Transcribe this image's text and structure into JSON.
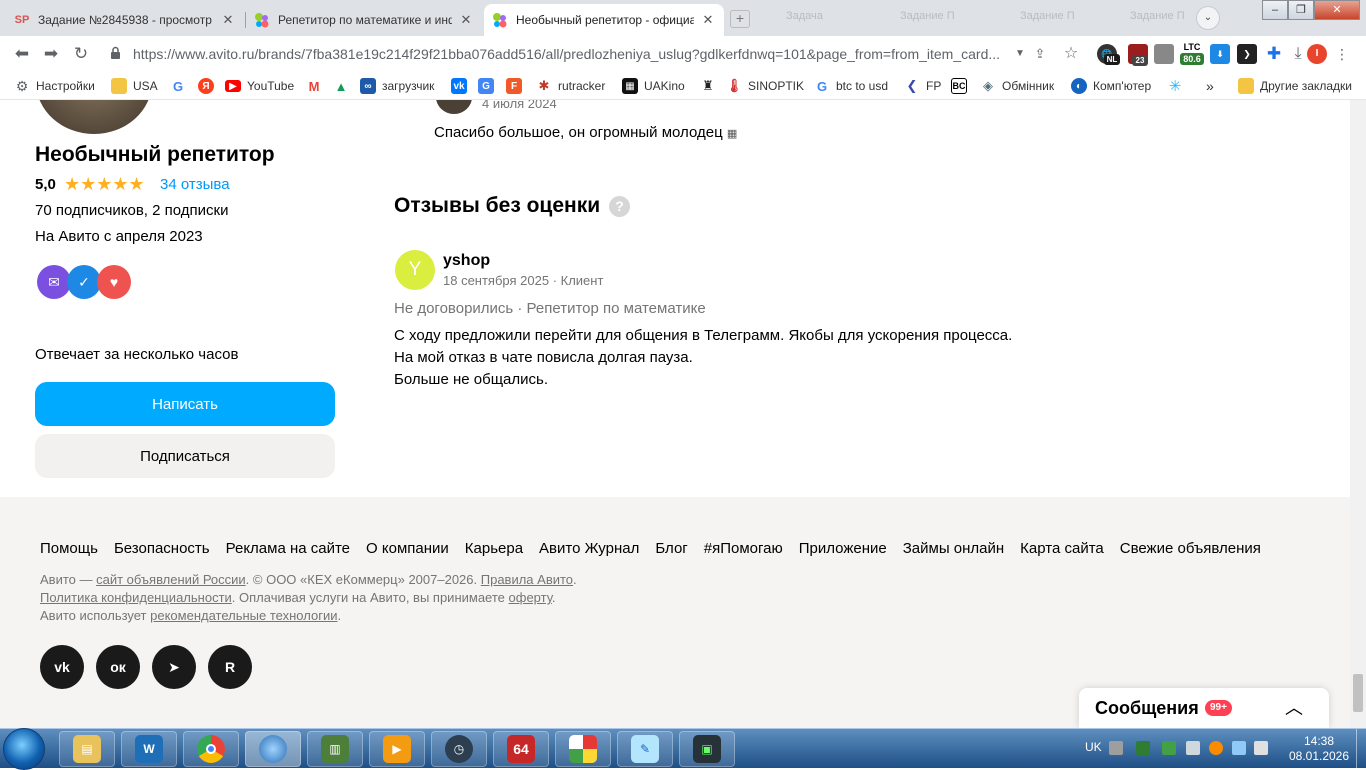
{
  "browser": {
    "tabs": [
      {
        "title": "Задание №2845938 - просмотр з",
        "favicon": "SP",
        "favicon_color": "#d9534f"
      },
      {
        "title": "Репетитор по математике и инфо",
        "favicon": "avito-icon"
      },
      {
        "title": "Необычный репетитор - официа",
        "favicon": "avito-icon",
        "active": true
      }
    ],
    "new_tab": "+",
    "background_tabs": [
      "Задача",
      "Задание П",
      "Задание П",
      "Задание П"
    ],
    "url": "https://www.avito.ru/brands/7fba381e19c214f29f21bba076add516/all/predlozheniya_uslug?gdlkerfdnwq=101&page_from=from_item_card...",
    "extensions": {
      "ltc_label": "LTC",
      "ltc_value": "80.6",
      "nl_badge": "NL",
      "count_badge": "23",
      "profile_letter": "I"
    },
    "bookmarks": [
      {
        "label": "Настройки",
        "icon": "gear-icon"
      },
      {
        "label": "USA",
        "icon": "folder-icon"
      },
      {
        "label": "",
        "icon": "google-icon"
      },
      {
        "label": "",
        "icon": "yandex-icon"
      },
      {
        "label": "YouTube",
        "icon": "youtube-icon"
      },
      {
        "label": "",
        "icon": "gmail-icon"
      },
      {
        "label": "",
        "icon": "drive-icon"
      },
      {
        "label": "загрузчик",
        "icon": "link-icon"
      },
      {
        "label": "",
        "icon": "vk-icon"
      },
      {
        "label": "",
        "icon": "translate-icon"
      },
      {
        "label": "",
        "icon": "f-icon"
      },
      {
        "label": "rutracker",
        "icon": "rutracker-icon"
      },
      {
        "label": "UAKino",
        "icon": "uakino-icon"
      },
      {
        "label": "",
        "icon": "bookmark-icon"
      },
      {
        "label": "SINOPTIK",
        "icon": "thermometer-icon"
      },
      {
        "label": "btc to usd",
        "icon": "google-icon"
      },
      {
        "label": "FP",
        "icon": "fp-icon"
      },
      {
        "label": "",
        "icon": "bc-icon"
      },
      {
        "label": "Обмінник",
        "icon": "exchange-icon"
      },
      {
        "label": "Комп'ютер",
        "icon": "computer-icon"
      },
      {
        "label": "",
        "icon": "snowflake-icon"
      }
    ],
    "bookmarks_more": "»",
    "other_bookmarks": "Другие закладки"
  },
  "profile": {
    "name": "Необычный репетитор",
    "rating": "5,0",
    "stars": "★★★★★",
    "reviews_link": "34 отзыва",
    "subscribers": "70 подписчиков, 2 подписки",
    "since": "На Авито с апреля 2023",
    "response_time": "Отвечает за несколько часов",
    "write_button": "Написать",
    "subscribe_button": "Подписаться"
  },
  "previous_review": {
    "date": "4 июля 2024",
    "text": "Спасибо большое, он огромный молодец"
  },
  "reviews_no_rating": {
    "title": "Отзывы без оценки",
    "help": "?",
    "review": {
      "avatar_letter": "Y",
      "author": "yshop",
      "meta": "18 сентября 2025 · Клиент",
      "status": "Не договорились · Репетитор по математике",
      "lines": [
        "С ходу предложили перейти для общения в Телеграмм. Якобы для ускорения процесса.",
        "На мой отказ в чате повисла долгая пауза.",
        "Больше не общались."
      ]
    }
  },
  "footer": {
    "links": [
      "Помощь",
      "Безопасность",
      "Реклама на сайте",
      "О компании",
      "Карьера",
      "Авито Журнал",
      "Блог",
      "#яПомогаю",
      "Приложение",
      "Займы онлайн",
      "Карта сайта",
      "Свежие объявления"
    ],
    "legal": {
      "l1_a": "Авито — ",
      "l1_link": "сайт объявлений России",
      "l1_b": ". © ООО «КЕХ еКоммерц» 2007–2026. ",
      "l1_link2": "Правила Авито",
      "l1_c": ".",
      "l2_link": "Политика конфиденциальности",
      "l2_a": ". Оплачивая услуги на Авито, вы принимаете ",
      "l2_link2": "оферту",
      "l2_b": ".",
      "l3_a": "Авито использует ",
      "l3_link": "рекомендательные технологии",
      "l3_b": "."
    },
    "social": [
      "VK",
      "OK",
      "Telegram",
      "R"
    ]
  },
  "messages": {
    "title": "Сообщения",
    "badge": "99+"
  },
  "taskbar": {
    "lang": "UK",
    "time": "14:38",
    "date": "08.01.2026",
    "apps": [
      "explorer",
      "wise-care",
      "chrome",
      "globe",
      "wifi-tool",
      "media-player",
      "clock-app",
      "aida64",
      "umbrella",
      "notepad",
      "monitor"
    ]
  },
  "colors": {
    "accent": "#00aaff",
    "link": "#0099f7",
    "star": "#ffb021",
    "badge_red": "#ff4053"
  }
}
